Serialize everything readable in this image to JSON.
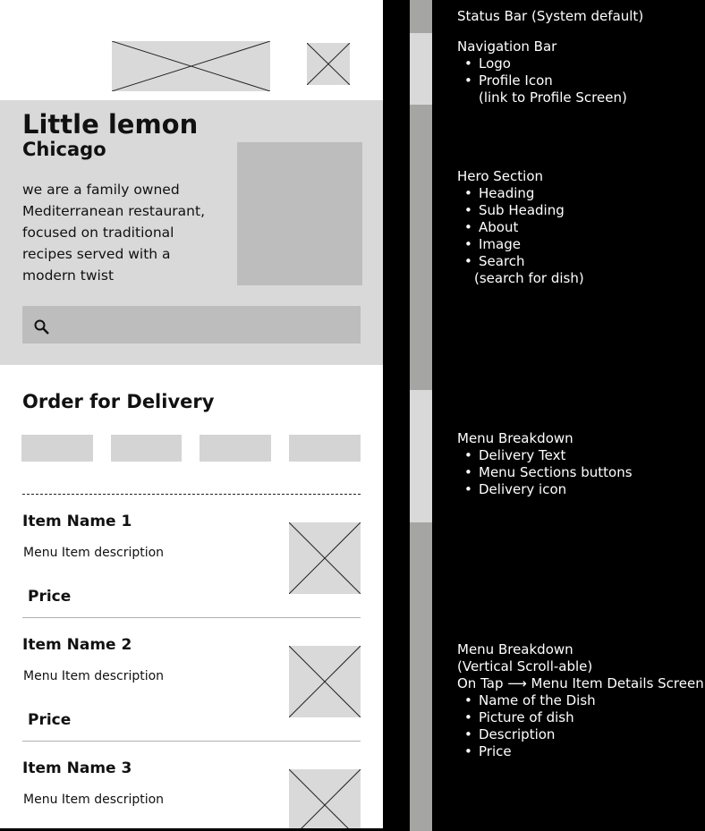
{
  "phone": {
    "hero": {
      "title": "Little lemon",
      "subtitle": "Chicago",
      "about": "we are a family owned Mediterranean restaurant, focused on traditional recipes served with a modern twist"
    },
    "delivery": {
      "title": "Order for Delivery"
    },
    "items": [
      {
        "name": "Item Name 1",
        "description": "Menu Item description",
        "price": "Price"
      },
      {
        "name": "Item Name 2",
        "description": "Menu Item description",
        "price": "Price"
      },
      {
        "name": "Item Name 3",
        "description": "Menu Item description"
      }
    ]
  },
  "annotations": {
    "status": {
      "title": "Status Bar (System default)"
    },
    "nav": {
      "title": "Navigation Bar",
      "items": [
        "Logo",
        "Profile Icon"
      ],
      "note": "(link to Profile Screen)"
    },
    "hero": {
      "title": "Hero Section",
      "items": [
        "Heading",
        "Sub Heading",
        "About",
        "Image",
        "Search"
      ],
      "note": "(search for dish)"
    },
    "menu1": {
      "title": "Menu Breakdown",
      "items": [
        "Delivery Text",
        "Menu Sections buttons",
        "Delivery icon"
      ]
    },
    "menu2": {
      "title": "Menu Breakdown",
      "line2": "(Vertical Scroll-able)",
      "line3": "On Tap ⟶ Menu Item Details Screen",
      "items": [
        "Name of the Dish",
        "Picture of dish",
        "Description",
        "Price"
      ]
    }
  },
  "colors": {
    "placeholder": "#d9d9d9",
    "strip_dark": "#a5a5a3",
    "strip_light": "#d9d9d9"
  }
}
